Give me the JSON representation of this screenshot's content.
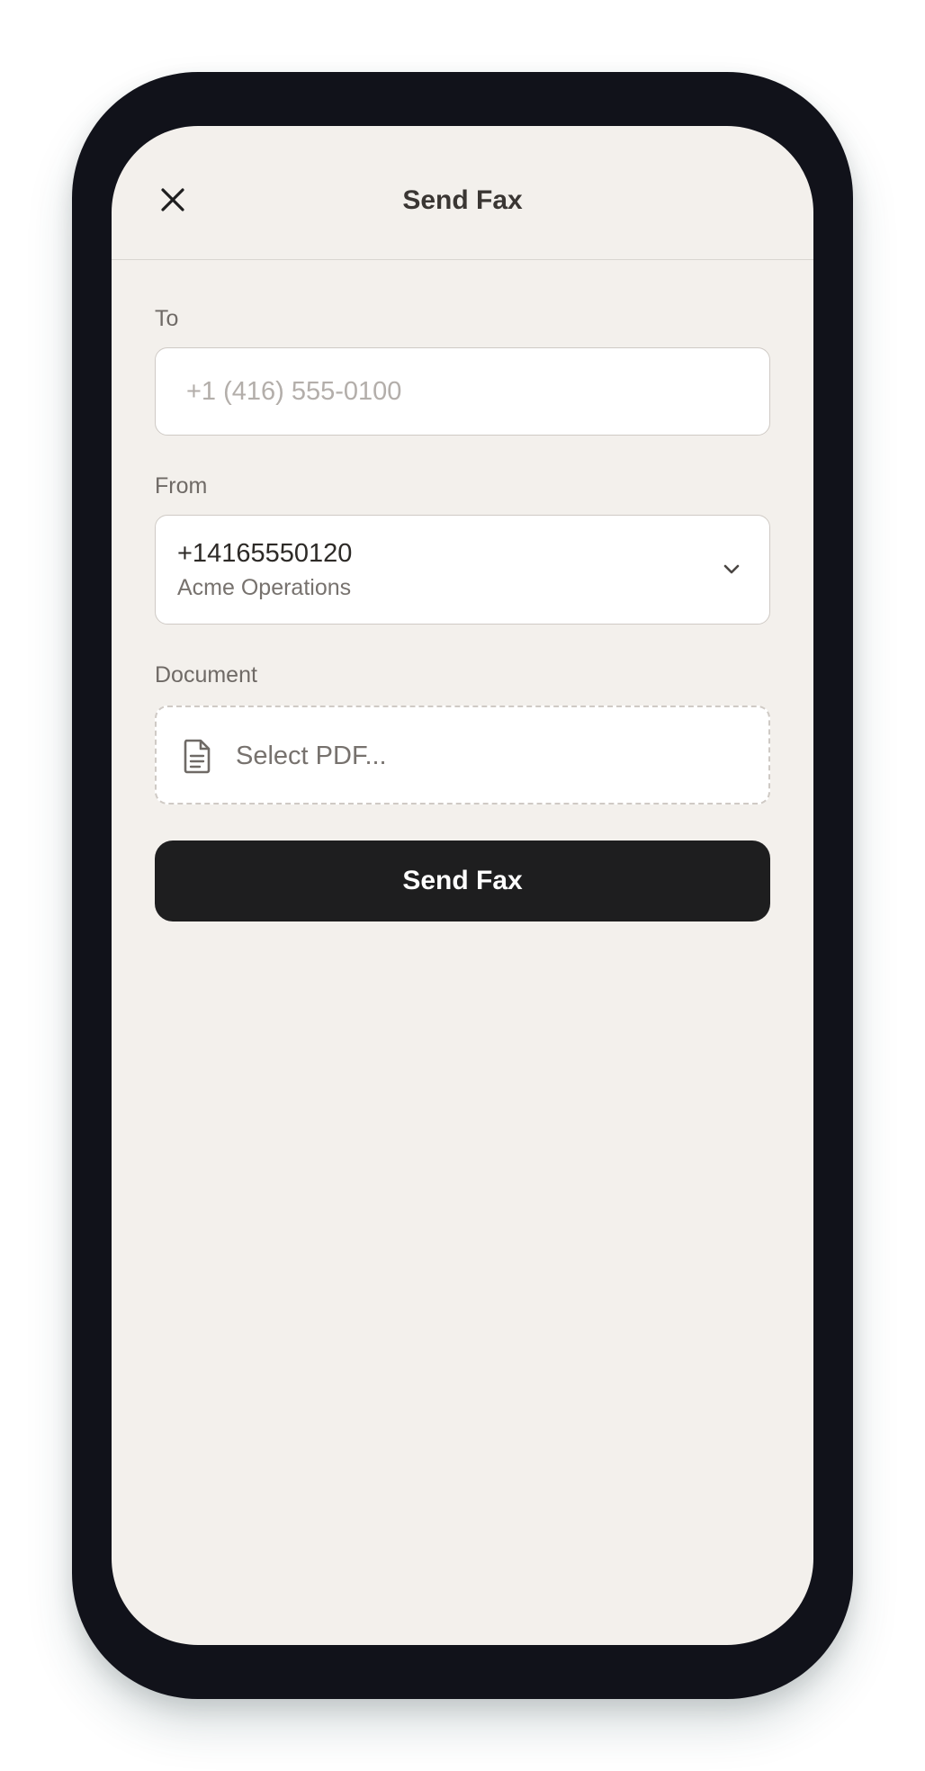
{
  "header": {
    "title": "Send Fax",
    "close_icon": "close-icon"
  },
  "form": {
    "to": {
      "label": "To",
      "value": "",
      "placeholder": "+1 (416) 555-0100"
    },
    "from": {
      "label": "From",
      "selected_number": "+14165550120",
      "selected_name": "Acme Operations",
      "icon": "chevron-down-icon"
    },
    "document": {
      "label": "Document",
      "placeholder": "Select PDF...",
      "icon": "document-icon"
    },
    "submit_label": "Send Fax"
  },
  "colors": {
    "screen_background": "#f3f0ec",
    "device_frame": "#11121a",
    "primary_button": "#1e1e1f",
    "primary_button_text": "#ffffff"
  }
}
